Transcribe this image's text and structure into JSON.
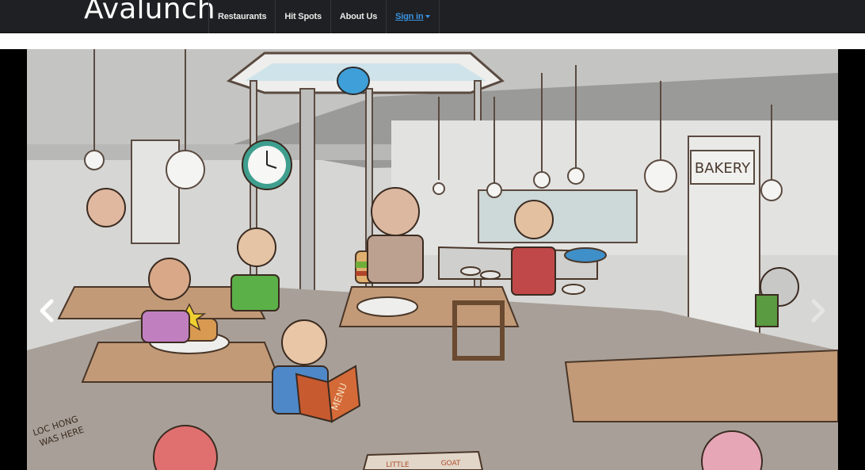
{
  "header": {
    "brand": "Avalunch",
    "nav": [
      {
        "label": "Restaurants"
      },
      {
        "label": "Hit Spots"
      },
      {
        "label": "About Us"
      },
      {
        "label": "Sign in"
      }
    ]
  },
  "carousel": {
    "signs": {
      "bakery": "BAKERY",
      "menu": "MENU",
      "graffiti_line1": "LOC HONG",
      "graffiti_line2": "WAS HERE",
      "mat_left": "LITTLE",
      "mat_right": "GOAT"
    },
    "prev_icon": "chevron-left-icon",
    "next_icon": "chevron-right-icon"
  },
  "colors": {
    "navbar_bg": "#1f2023",
    "link_blue": "#3a93e0",
    "wall": "#d8d8d6",
    "floor": "#a69e96",
    "table_wood": "#c29a77"
  }
}
